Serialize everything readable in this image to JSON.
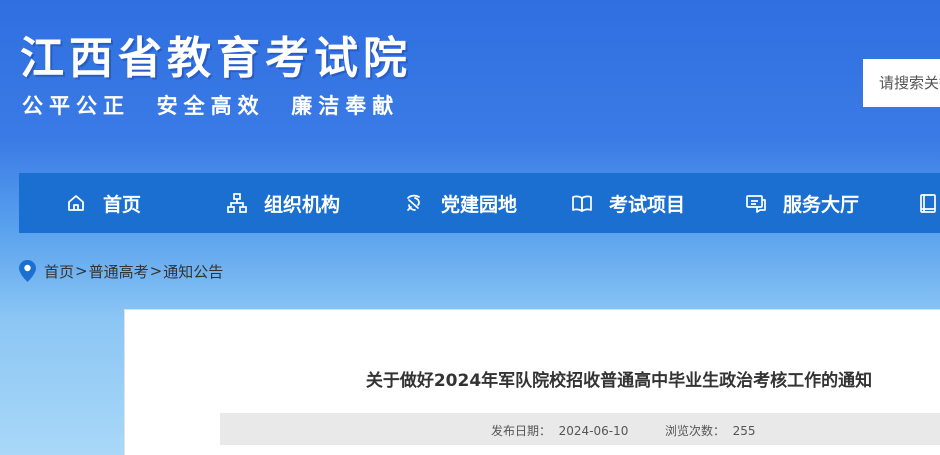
{
  "header": {
    "site_title": "江西省教育考试院",
    "motto": "公平公正  安全高效  廉洁奉献",
    "search_placeholder": "请搜索关键字"
  },
  "nav": {
    "items": [
      {
        "label": "首页",
        "icon": "home-icon"
      },
      {
        "label": "组织机构",
        "icon": "org-chart-icon"
      },
      {
        "label": "党建园地",
        "icon": "party-emblem-icon"
      },
      {
        "label": "考试项目",
        "icon": "open-book-icon"
      },
      {
        "label": "服务大厅",
        "icon": "service-chat-icon"
      },
      {
        "label": "",
        "icon": "book-icon"
      }
    ]
  },
  "breadcrumb": {
    "icon": "location-pin-icon",
    "items": [
      "首页",
      "普通高考",
      "通知公告"
    ],
    "separator": ">"
  },
  "article": {
    "title": "关于做好2024年军队院校招收普通高中毕业生政治考核工作的通知",
    "publish_label": "发布日期：",
    "publish_date": "2024-06-10",
    "views_label": "浏览次数：",
    "views": "255"
  },
  "colors": {
    "nav_bg": "#1b6fd0",
    "header_gradient_top": "#2f6fe0",
    "page_gradient_bottom": "#a9d8f8",
    "pin_color": "#1b6fd0"
  }
}
